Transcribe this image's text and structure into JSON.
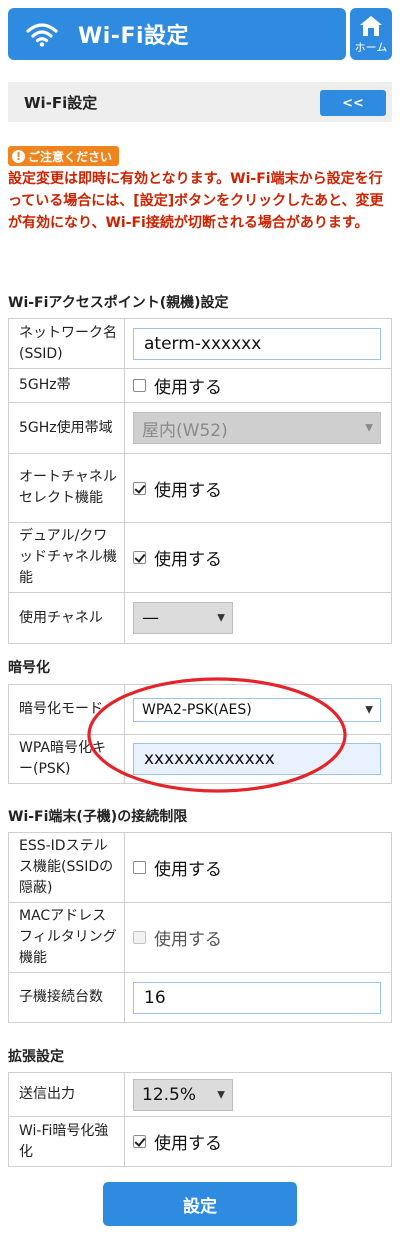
{
  "header": {
    "title": "Wi-Fi設定",
    "icon": "wifi-icon"
  },
  "home": {
    "label": "ホーム",
    "icon": "home-icon"
  },
  "page": {
    "title": "Wi-Fi設定",
    "back_label": "<<"
  },
  "notice": {
    "badge": "ご注意ください",
    "text": "設定変更は即時に有効となります。Wi-Fi端末から設定を行っている場合には、[設定]ボタンをクリックしたあと、変更が有効になり、Wi-Fi接続が切断される場合があります。"
  },
  "ap_section": {
    "title": "Wi-Fiアクセスポイント(親機)設定",
    "ssid": {
      "label": "ネットワーク名(SSID)",
      "value": "aterm-xxxxxx"
    },
    "band5g": {
      "label": "5GHz帯",
      "option": "使用する",
      "checked": false
    },
    "band5g_use": {
      "label": "5GHz使用帯域",
      "value": "屋内(W52)"
    },
    "auto_channel": {
      "label": "オートチャネルセレクト機能",
      "option": "使用する",
      "checked": true
    },
    "dual_channel": {
      "label": "デュアル/クワッドチャネル機能",
      "option": "使用する",
      "checked": true
    },
    "channel": {
      "label": "使用チャネル",
      "value": "—"
    }
  },
  "encryption_section": {
    "title": "暗号化",
    "mode": {
      "label": "暗号化モード",
      "value": "WPA2-PSK(AES)"
    },
    "key": {
      "label": "WPA暗号化キー(PSK)",
      "value": "xxxxxxxxxxxxx"
    }
  },
  "client_section": {
    "title": "Wi-Fi端末(子機)の接続制限",
    "essid_stealth": {
      "label": "ESS-IDステルス機能(SSIDの隠蔽)",
      "option": "使用する",
      "checked": false
    },
    "mac_filter": {
      "label": "MACアドレスフィルタリング機能",
      "option": "使用する",
      "checked": false
    },
    "max_clients": {
      "label": "子機接続台数",
      "value": "16"
    }
  },
  "extended_section": {
    "title": "拡張設定",
    "tx_power": {
      "label": "送信出力",
      "value": "12.5%"
    },
    "wifi_enc_boost": {
      "label": "Wi-Fi暗号化強化",
      "option": "使用する",
      "checked": true
    }
  },
  "submit": {
    "label": "設定"
  },
  "colors": {
    "accent": "#2f8be0",
    "warning": "#cc2200",
    "badge": "#f0841f",
    "annotation": "#e3242b"
  }
}
